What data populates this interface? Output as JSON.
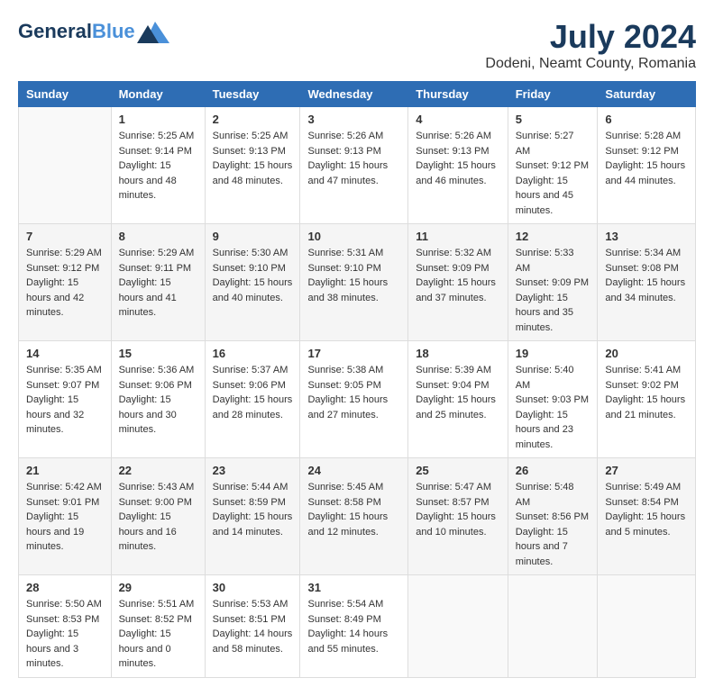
{
  "header": {
    "logo_line1": "General",
    "logo_line2": "Blue",
    "month_year": "July 2024",
    "location": "Dodeni, Neamt County, Romania"
  },
  "columns": [
    "Sunday",
    "Monday",
    "Tuesday",
    "Wednesday",
    "Thursday",
    "Friday",
    "Saturday"
  ],
  "weeks": [
    {
      "days": [
        {
          "date": "",
          "sunrise": "",
          "sunset": "",
          "daylight": ""
        },
        {
          "date": "1",
          "sunrise": "Sunrise: 5:25 AM",
          "sunset": "Sunset: 9:14 PM",
          "daylight": "Daylight: 15 hours and 48 minutes."
        },
        {
          "date": "2",
          "sunrise": "Sunrise: 5:25 AM",
          "sunset": "Sunset: 9:13 PM",
          "daylight": "Daylight: 15 hours and 48 minutes."
        },
        {
          "date": "3",
          "sunrise": "Sunrise: 5:26 AM",
          "sunset": "Sunset: 9:13 PM",
          "daylight": "Daylight: 15 hours and 47 minutes."
        },
        {
          "date": "4",
          "sunrise": "Sunrise: 5:26 AM",
          "sunset": "Sunset: 9:13 PM",
          "daylight": "Daylight: 15 hours and 46 minutes."
        },
        {
          "date": "5",
          "sunrise": "Sunrise: 5:27 AM",
          "sunset": "Sunset: 9:12 PM",
          "daylight": "Daylight: 15 hours and 45 minutes."
        },
        {
          "date": "6",
          "sunrise": "Sunrise: 5:28 AM",
          "sunset": "Sunset: 9:12 PM",
          "daylight": "Daylight: 15 hours and 44 minutes."
        }
      ]
    },
    {
      "days": [
        {
          "date": "7",
          "sunrise": "Sunrise: 5:29 AM",
          "sunset": "Sunset: 9:12 PM",
          "daylight": "Daylight: 15 hours and 42 minutes."
        },
        {
          "date": "8",
          "sunrise": "Sunrise: 5:29 AM",
          "sunset": "Sunset: 9:11 PM",
          "daylight": "Daylight: 15 hours and 41 minutes."
        },
        {
          "date": "9",
          "sunrise": "Sunrise: 5:30 AM",
          "sunset": "Sunset: 9:10 PM",
          "daylight": "Daylight: 15 hours and 40 minutes."
        },
        {
          "date": "10",
          "sunrise": "Sunrise: 5:31 AM",
          "sunset": "Sunset: 9:10 PM",
          "daylight": "Daylight: 15 hours and 38 minutes."
        },
        {
          "date": "11",
          "sunrise": "Sunrise: 5:32 AM",
          "sunset": "Sunset: 9:09 PM",
          "daylight": "Daylight: 15 hours and 37 minutes."
        },
        {
          "date": "12",
          "sunrise": "Sunrise: 5:33 AM",
          "sunset": "Sunset: 9:09 PM",
          "daylight": "Daylight: 15 hours and 35 minutes."
        },
        {
          "date": "13",
          "sunrise": "Sunrise: 5:34 AM",
          "sunset": "Sunset: 9:08 PM",
          "daylight": "Daylight: 15 hours and 34 minutes."
        }
      ]
    },
    {
      "days": [
        {
          "date": "14",
          "sunrise": "Sunrise: 5:35 AM",
          "sunset": "Sunset: 9:07 PM",
          "daylight": "Daylight: 15 hours and 32 minutes."
        },
        {
          "date": "15",
          "sunrise": "Sunrise: 5:36 AM",
          "sunset": "Sunset: 9:06 PM",
          "daylight": "Daylight: 15 hours and 30 minutes."
        },
        {
          "date": "16",
          "sunrise": "Sunrise: 5:37 AM",
          "sunset": "Sunset: 9:06 PM",
          "daylight": "Daylight: 15 hours and 28 minutes."
        },
        {
          "date": "17",
          "sunrise": "Sunrise: 5:38 AM",
          "sunset": "Sunset: 9:05 PM",
          "daylight": "Daylight: 15 hours and 27 minutes."
        },
        {
          "date": "18",
          "sunrise": "Sunrise: 5:39 AM",
          "sunset": "Sunset: 9:04 PM",
          "daylight": "Daylight: 15 hours and 25 minutes."
        },
        {
          "date": "19",
          "sunrise": "Sunrise: 5:40 AM",
          "sunset": "Sunset: 9:03 PM",
          "daylight": "Daylight: 15 hours and 23 minutes."
        },
        {
          "date": "20",
          "sunrise": "Sunrise: 5:41 AM",
          "sunset": "Sunset: 9:02 PM",
          "daylight": "Daylight: 15 hours and 21 minutes."
        }
      ]
    },
    {
      "days": [
        {
          "date": "21",
          "sunrise": "Sunrise: 5:42 AM",
          "sunset": "Sunset: 9:01 PM",
          "daylight": "Daylight: 15 hours and 19 minutes."
        },
        {
          "date": "22",
          "sunrise": "Sunrise: 5:43 AM",
          "sunset": "Sunset: 9:00 PM",
          "daylight": "Daylight: 15 hours and 16 minutes."
        },
        {
          "date": "23",
          "sunrise": "Sunrise: 5:44 AM",
          "sunset": "Sunset: 8:59 PM",
          "daylight": "Daylight: 15 hours and 14 minutes."
        },
        {
          "date": "24",
          "sunrise": "Sunrise: 5:45 AM",
          "sunset": "Sunset: 8:58 PM",
          "daylight": "Daylight: 15 hours and 12 minutes."
        },
        {
          "date": "25",
          "sunrise": "Sunrise: 5:47 AM",
          "sunset": "Sunset: 8:57 PM",
          "daylight": "Daylight: 15 hours and 10 minutes."
        },
        {
          "date": "26",
          "sunrise": "Sunrise: 5:48 AM",
          "sunset": "Sunset: 8:56 PM",
          "daylight": "Daylight: 15 hours and 7 minutes."
        },
        {
          "date": "27",
          "sunrise": "Sunrise: 5:49 AM",
          "sunset": "Sunset: 8:54 PM",
          "daylight": "Daylight: 15 hours and 5 minutes."
        }
      ]
    },
    {
      "days": [
        {
          "date": "28",
          "sunrise": "Sunrise: 5:50 AM",
          "sunset": "Sunset: 8:53 PM",
          "daylight": "Daylight: 15 hours and 3 minutes."
        },
        {
          "date": "29",
          "sunrise": "Sunrise: 5:51 AM",
          "sunset": "Sunset: 8:52 PM",
          "daylight": "Daylight: 15 hours and 0 minutes."
        },
        {
          "date": "30",
          "sunrise": "Sunrise: 5:53 AM",
          "sunset": "Sunset: 8:51 PM",
          "daylight": "Daylight: 14 hours and 58 minutes."
        },
        {
          "date": "31",
          "sunrise": "Sunrise: 5:54 AM",
          "sunset": "Sunset: 8:49 PM",
          "daylight": "Daylight: 14 hours and 55 minutes."
        },
        {
          "date": "",
          "sunrise": "",
          "sunset": "",
          "daylight": ""
        },
        {
          "date": "",
          "sunrise": "",
          "sunset": "",
          "daylight": ""
        },
        {
          "date": "",
          "sunrise": "",
          "sunset": "",
          "daylight": ""
        }
      ]
    }
  ]
}
